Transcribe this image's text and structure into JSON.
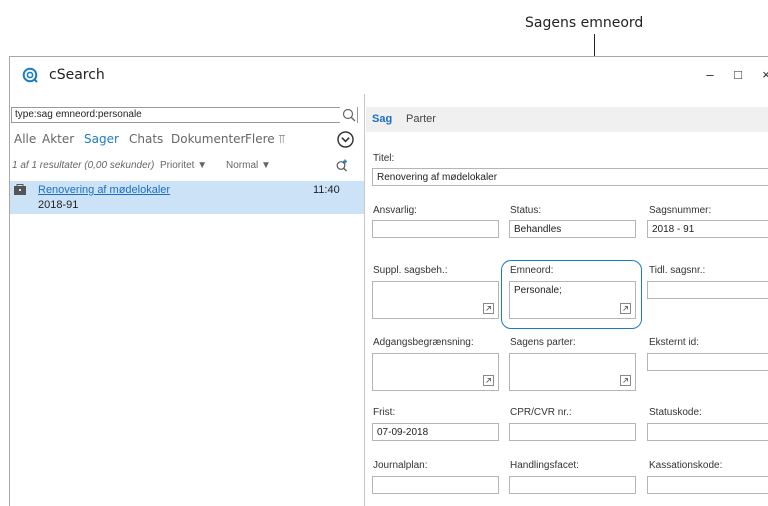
{
  "callout": {
    "label": "Sagens emneord"
  },
  "window": {
    "title": "cSearch",
    "minimize": "–",
    "maximize": "□",
    "close": "×"
  },
  "search": {
    "value": "type:sag emneord:personale"
  },
  "filters": [
    {
      "label": "Alle",
      "active": false
    },
    {
      "label": "Akter",
      "active": false
    },
    {
      "label": "Sager",
      "active": true
    },
    {
      "label": "Chats",
      "active": false
    },
    {
      "label": "Dokumenter",
      "active": false
    },
    {
      "label": "Flere ⫪",
      "active": false
    }
  ],
  "results": {
    "count": "1 af 1 resultater (0,00 sekunder)",
    "sort_priority": "Prioritet ▼",
    "sort_normal": "Normal ▼"
  },
  "result_item": {
    "title": "Renovering af mødelokaler",
    "time": "11:40",
    "case_number": "2018-91"
  },
  "tabs": [
    {
      "label": "Sag",
      "active": true
    },
    {
      "label": "Parter",
      "active": false
    }
  ],
  "form": {
    "titel_label": "Titel:",
    "titel_value": "Renovering af mødelokaler",
    "ansvarlig_label": "Ansvarlig:",
    "ansvarlig_value": "",
    "status_label": "Status:",
    "status_value": "Behandles",
    "sagsnummer_label": "Sagsnummer:",
    "sagsnummer_value": "2018 - 91",
    "suppl_label": "Suppl. sagsbeh.:",
    "emneord_label": "Emneord:",
    "emneord_value": "Personale;",
    "tidl_label": "Tidl. sagsnr.:",
    "adgang_label": "Adgangsbegrænsning:",
    "parter_label": "Sagens parter:",
    "eksternt_label": "Eksternt id:",
    "frist_label": "Frist:",
    "frist_value": "07-09-2018",
    "cpr_label": "CPR/CVR nr.:",
    "statuskode_label": "Statuskode:",
    "journalplan_label": "Journalplan:",
    "handlingsfacet_label": "Handlingsfacet:",
    "kassationskode_label": "Kassationskode:"
  },
  "colors": {
    "accent": "#1b7dc1",
    "selection": "#cce3f7"
  },
  "icons": [
    "csearch-logo-icon",
    "search-icon",
    "chevron-down-circle-icon",
    "refresh-icon",
    "case-icon",
    "expand-field-icon"
  ]
}
